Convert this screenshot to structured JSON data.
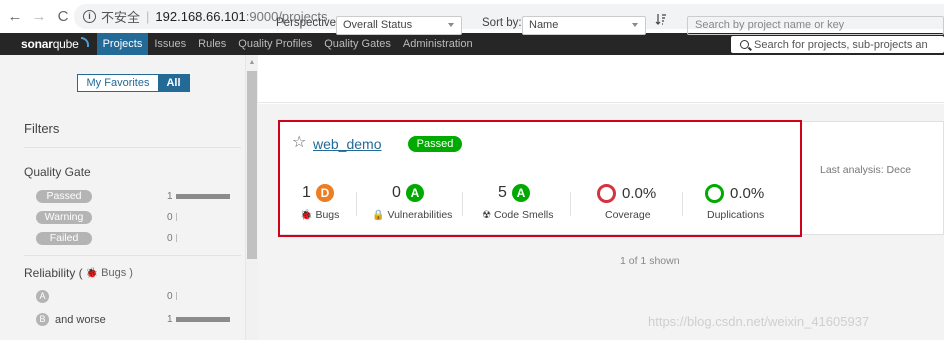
{
  "browser": {
    "back": "←",
    "forward": "→",
    "reload": "C",
    "info": "i",
    "security_label": "不安全",
    "separator": "|",
    "url_host": "192.168.66.101",
    "url_path": ":9000/projects"
  },
  "nav": {
    "logo_bold": "sonar",
    "logo_light": "qube",
    "items": [
      "Projects",
      "Issues",
      "Rules",
      "Quality Profiles",
      "Quality Gates",
      "Administration"
    ],
    "active": "Projects",
    "search_placeholder": "Search for projects, sub-projects an"
  },
  "sidebar": {
    "toggle_favorites": "My Favorites",
    "toggle_all": "All",
    "filters_title": "Filters",
    "quality_gate": {
      "title": "Quality Gate",
      "items": [
        {
          "label": "Passed",
          "count": "1",
          "share": 1
        },
        {
          "label": "Warning",
          "count": "0",
          "share": 0
        },
        {
          "label": "Failed",
          "count": "0",
          "share": 0
        }
      ]
    },
    "reliability": {
      "title": "Reliability (",
      "bug_icon": "🐞",
      "title_suffix": "Bugs )",
      "items": [
        {
          "rating": "A",
          "extra": "",
          "count": "0",
          "share": 0
        },
        {
          "rating": "B",
          "extra": "and worse",
          "count": "1",
          "share": 1
        }
      ]
    }
  },
  "toolbar": {
    "perspective_label": "Perspective:",
    "perspective_value": "Overall Status",
    "sort_label": "Sort by:",
    "sort_value": "Name",
    "search_placeholder": "Search by project name or key"
  },
  "project": {
    "name": "web_demo",
    "status": "Passed",
    "last_analysis": "Last analysis: Dece",
    "measures": [
      {
        "key": "bugs",
        "value": "1",
        "rating": "D",
        "rating_color": "#ed7d20",
        "icon": "🐞",
        "label": "Bugs"
      },
      {
        "key": "vulnerabilities",
        "value": "0",
        "rating": "A",
        "rating_color": "#00aa00",
        "icon": "🔒",
        "label": "Vulnerabilities"
      },
      {
        "key": "code-smells",
        "value": "5",
        "rating": "A",
        "rating_color": "#00aa00",
        "icon": "☢",
        "label": "Code Smells"
      }
    ],
    "coverage": {
      "value": "0.0%",
      "label": "Coverage",
      "ring_color": "#d4333f"
    },
    "duplications": {
      "value": "0.0%",
      "label": "Duplications",
      "ring_color": "#00aa00"
    }
  },
  "footer": {
    "shown": "1 of 1 shown",
    "watermark": "https://blog.csdn.net/weixin_41605937"
  },
  "colors": {
    "nav_bg": "#262626",
    "accent": "#236a97",
    "passed": "#00aa00",
    "highlight": "#d0021b"
  }
}
